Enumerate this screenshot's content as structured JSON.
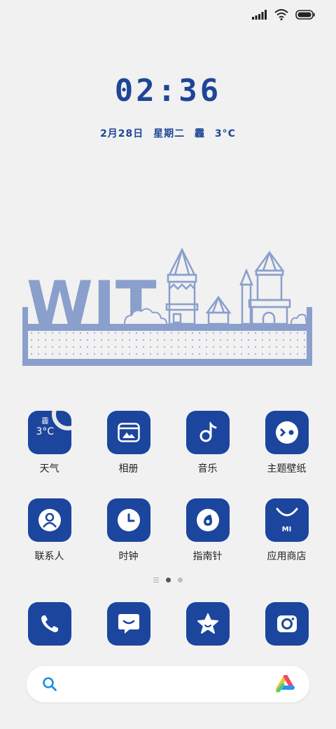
{
  "status_bar": {
    "icons": [
      "signal-icon",
      "wifi-icon",
      "battery-icon"
    ]
  },
  "lock": {
    "time": "02:36",
    "date": "2月28日",
    "weekday": "星期二",
    "weather": "霾",
    "temp": "3°C"
  },
  "widget": {
    "text": "WIT"
  },
  "apps_row1": [
    {
      "label": "天气",
      "icon": "weather-icon",
      "tile_top": "霾",
      "tile_temp": "3°C"
    },
    {
      "label": "相册",
      "icon": "gallery-icon"
    },
    {
      "label": "音乐",
      "icon": "music-icon"
    },
    {
      "label": "主题壁纸",
      "icon": "themes-icon"
    }
  ],
  "apps_row2": [
    {
      "label": "联系人",
      "icon": "contacts-icon"
    },
    {
      "label": "时钟",
      "icon": "clock-icon"
    },
    {
      "label": "指南针",
      "icon": "compass-icon"
    },
    {
      "label": "应用商店",
      "icon": "app-store-icon",
      "tile_text": "MI"
    }
  ],
  "page_indicator": {
    "pages": 2,
    "current": 1
  },
  "dock": [
    {
      "icon": "phone-icon"
    },
    {
      "icon": "messages-icon"
    },
    {
      "icon": "favorites-star-icon"
    },
    {
      "icon": "camera-icon"
    }
  ],
  "search_bar": {
    "left_icon": "search-icon",
    "right_icon": "app-vault-icon"
  },
  "colors": {
    "accent": "#1c459d",
    "background": "#f1f1f1",
    "widget": "#8a9fcc"
  }
}
